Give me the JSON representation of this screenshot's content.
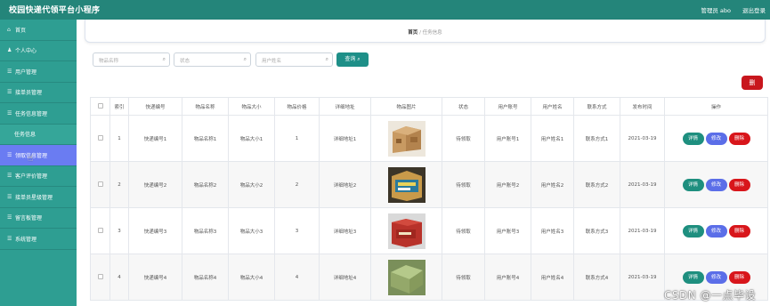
{
  "header": {
    "title": "校园快递代领平台小程序",
    "user": "管理员 abo",
    "logout": "退出登录"
  },
  "sidebar": {
    "items": [
      {
        "label": "首页",
        "icon": "home-icon"
      },
      {
        "label": "个人中心",
        "icon": "user-icon"
      },
      {
        "label": "用户管理",
        "icon": "menu-icon"
      },
      {
        "label": "接单员管理",
        "icon": "menu-icon"
      },
      {
        "label": "任务信息管理",
        "icon": "menu-icon"
      },
      {
        "label": "任务信息",
        "icon": ""
      },
      {
        "label": "领取信息管理",
        "icon": "menu-icon"
      },
      {
        "label": "客户评价管理",
        "icon": "menu-icon"
      },
      {
        "label": "接单员星级管理",
        "icon": "menu-icon"
      },
      {
        "label": "留言板管理",
        "icon": "menu-icon"
      },
      {
        "label": "系统管理",
        "icon": "menu-icon"
      }
    ]
  },
  "breadcrumb": {
    "home": "首页",
    "separator": "/",
    "current": "任务信息"
  },
  "search": {
    "name_placeholder": "物品名称",
    "status_placeholder": "状态",
    "username_placeholder": "用户姓名",
    "query_label": "查询",
    "delete_label": "删"
  },
  "table": {
    "headers": [
      "",
      "索引",
      "快递编号",
      "物品名称",
      "物品大小",
      "物品价格",
      "详细地址",
      "物品图片",
      "状态",
      "用户账号",
      "用户姓名",
      "联系方式",
      "发布时间",
      "操作"
    ],
    "actions": {
      "detail": "详情",
      "edit": "修改",
      "delete": "删除"
    },
    "rows": [
      {
        "index": "1",
        "code": "快递编号1",
        "name": "物品名称1",
        "size": "物品大小1",
        "price": "1",
        "address": "详细地址1",
        "status": "待领取",
        "account": "用户账号1",
        "username": "用户姓名1",
        "contact": "联系方式1",
        "date": "2021-03-19"
      },
      {
        "index": "2",
        "code": "快递编号2",
        "name": "物品名称2",
        "size": "物品大小2",
        "price": "2",
        "address": "详细地址2",
        "status": "待领取",
        "account": "用户账号2",
        "username": "用户姓名2",
        "contact": "联系方式2",
        "date": "2021-03-19"
      },
      {
        "index": "3",
        "code": "快递编号3",
        "name": "物品名称3",
        "size": "物品大小3",
        "price": "3",
        "address": "详细地址3",
        "status": "待领取",
        "account": "用户账号3",
        "username": "用户姓名3",
        "contact": "联系方式3",
        "date": "2021-03-19"
      },
      {
        "index": "4",
        "code": "快递编号4",
        "name": "物品名称4",
        "size": "物品大小4",
        "price": "4",
        "address": "详细地址4",
        "status": "待领取",
        "account": "用户账号4",
        "username": "用户姓名4",
        "contact": "联系方式4",
        "date": "2021-03-19"
      }
    ]
  },
  "watermark": "CSDN @一点毕设",
  "colors": {
    "header": "#24857a",
    "sidebar": "#2e9e92",
    "active": "#6a7cf2",
    "detail": "#1e8f7f",
    "edit": "#5b6ee8",
    "delete": "#d8161b"
  }
}
